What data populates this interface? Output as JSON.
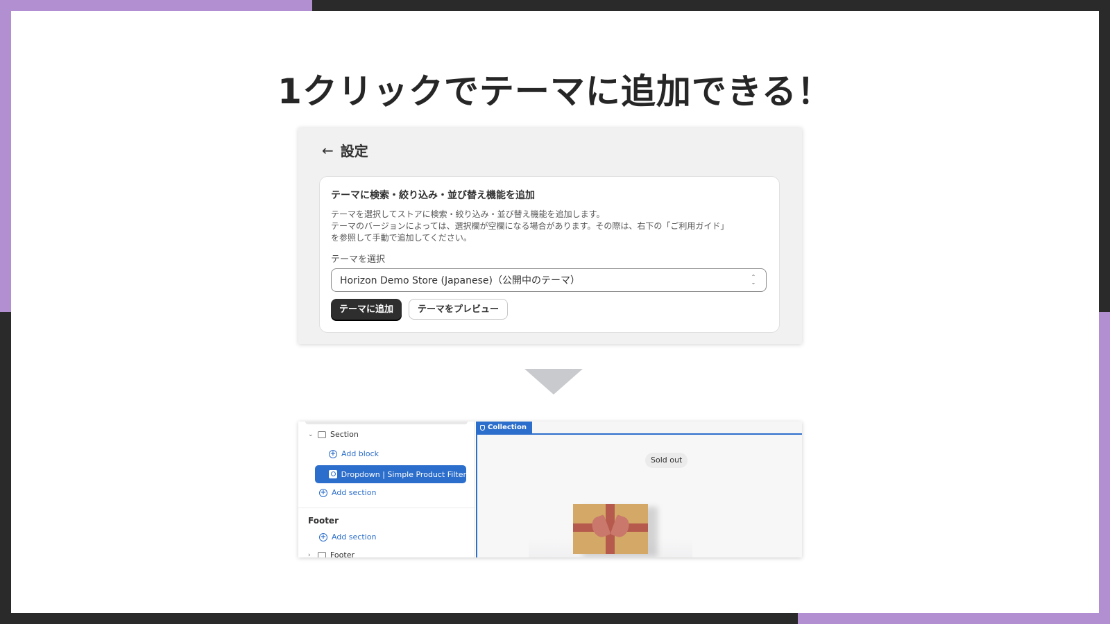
{
  "headline": "1クリックでテーマに追加できる！",
  "settings": {
    "back_icon": "arrow-left-icon",
    "title": "設定",
    "card": {
      "title": "テーマに検索・絞り込み・並び替え機能を追加",
      "description_lines": [
        "テーマを選択してストアに検索・絞り込み・並び替え機能を追加します。",
        "テーマのバージョンによっては、選択欄が空欄になる場合があります。その際は、右下の「ご利用ガイド」",
        "を参照して手動で追加してください。"
      ],
      "field_label": "テーマを選択",
      "select_value": "Horizon Demo Store (Japanese)（公開中のテーマ）",
      "primary_button": "テーマに追加",
      "secondary_button": "テーマをプレビュー"
    }
  },
  "editor": {
    "sidebar": {
      "section_label": "Section",
      "add_block": "Add block",
      "selected_block": "Dropdown | Simple Product Filter",
      "add_section": "Add section",
      "footer_heading": "Footer",
      "footer_add_section": "Add section",
      "footer_item": "Footer"
    },
    "preview": {
      "tag": "Collection",
      "badge": "Sold out"
    }
  },
  "colors": {
    "accent": "#b18fd1",
    "dark": "#2a2a2a",
    "editor_blue": "#2c6ecb"
  }
}
